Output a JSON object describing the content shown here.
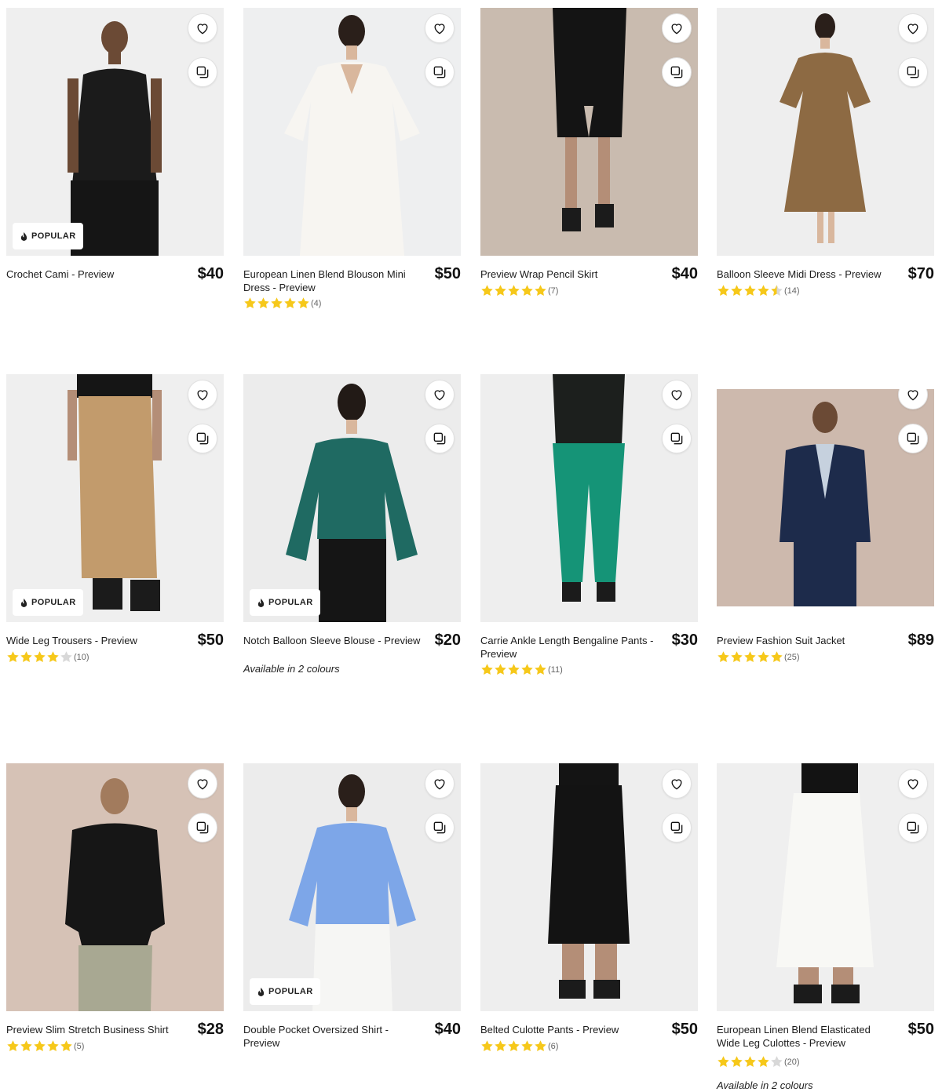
{
  "colors": {
    "star": "#f6c81a",
    "star_empty": "#d8d8d8",
    "badge_flame": "#222222"
  },
  "products": [
    {
      "name": "Crochet Cami - Preview",
      "price": "$40",
      "badge": "POPULAR",
      "bg": "#efefef",
      "rating": null,
      "count": null,
      "avail": null
    },
    {
      "name": "European Linen Blend Blouson Mini Dress - Preview",
      "price": "$50",
      "badge": null,
      "bg": "#eeeff0",
      "rating": 5,
      "count": "(4)",
      "avail": null
    },
    {
      "name": "Preview Wrap Pencil Skirt",
      "price": "$40",
      "badge": null,
      "bg": "#c9bbaf",
      "rating": 5,
      "count": "(7)",
      "avail": null
    },
    {
      "name": "Balloon Sleeve Midi Dress - Preview",
      "price": "$70",
      "badge": null,
      "bg": "#eeeeee",
      "rating": 4.5,
      "count": "(14)",
      "avail": null
    },
    {
      "name": "Wide Leg Trousers - Preview",
      "price": "$50",
      "badge": "POPULAR",
      "bg": "#efefef",
      "rating": 4,
      "count": "(10)",
      "avail": null
    },
    {
      "name": "Notch Balloon Sleeve Blouse - Preview",
      "price": "$20",
      "badge": "POPULAR",
      "bg": "#ececec",
      "rating": null,
      "count": null,
      "avail": "Available in 2 colours"
    },
    {
      "name": "Carrie Ankle Length Bengaline Pants - Preview",
      "price": "$30",
      "badge": null,
      "bg": "#eeeeee",
      "rating": 5,
      "count": "(11)",
      "avail": null
    },
    {
      "name": "Preview Fashion Suit Jacket",
      "price": "$89",
      "badge": null,
      "bg": "#cdb9ad",
      "rating": 5,
      "count": "(25)",
      "avail": null
    },
    {
      "name": "Preview Slim Stretch Business Shirt",
      "price": "$28",
      "badge": null,
      "bg": "#d6c2b6",
      "rating": 5,
      "count": "(5)",
      "avail": null
    },
    {
      "name": "Double Pocket Oversized Shirt - Preview",
      "price": "$40",
      "badge": "POPULAR",
      "bg": "#ececec",
      "rating": null,
      "count": null,
      "avail": null
    },
    {
      "name": "Belted Culotte Pants - Preview",
      "price": "$50",
      "badge": null,
      "bg": "#eeeeee",
      "rating": 5,
      "count": "(6)",
      "avail": null
    },
    {
      "name": "European Linen Blend Elasticated Wide Leg Culottes - Preview",
      "price": "$50",
      "badge": null,
      "bg": "#efefef",
      "rating": 4,
      "count": "(20)",
      "avail": "Available in 2 colours"
    }
  ]
}
